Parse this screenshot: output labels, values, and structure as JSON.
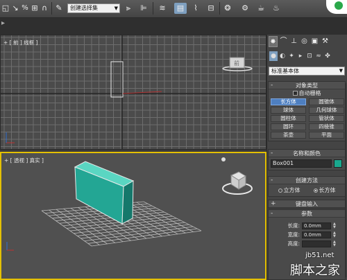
{
  "toolbar": {
    "selection_set_value": "创建选择集",
    "icons": [
      "select-object-icon",
      "select-name-icon",
      "percent-snap-icon",
      "spinner-snap-icon",
      "magnet-icon",
      "edit-named-selections-icon",
      "mirror-icon",
      "align-icon",
      "layer-manager-icon",
      "ribbon-icon",
      "curve-editor-icon",
      "schematic-view-icon",
      "material-editor-icon",
      "render-setup-icon",
      "rendered-frame-icon",
      "render-icon"
    ]
  },
  "viewports": {
    "top_label": "+ [ 前 ] 线框 ]",
    "persp_label": "+ [ 透视 ] 真实 ]",
    "viewcube_top_text": "前"
  },
  "panel": {
    "tabs": [
      "create-tab",
      "modify-tab",
      "hierarchy-tab",
      "motion-tab",
      "display-tab",
      "utilities-tab"
    ],
    "category_value": "标准基本体",
    "object_type": {
      "header": "对象类型",
      "autogrid_label": "自动栅格",
      "buttons": [
        "长方体",
        "圆锥体",
        "球体",
        "几何球体",
        "圆柱体",
        "管状体",
        "圆环",
        "四棱锥",
        "茶壶",
        "平面"
      ],
      "active_button": "长方体"
    },
    "name_color": {
      "header": "名称和颜色",
      "name_value": "Box001",
      "color": "#19a88e"
    },
    "creation_method": {
      "header": "创建方法",
      "options": [
        "立方体",
        "长方体"
      ],
      "selected": "长方体"
    },
    "keyboard_entry": {
      "header": "键盘输入"
    },
    "parameters": {
      "header": "参数",
      "length_label": "长度:",
      "length_value": "0.0mm",
      "width_label": "宽度:",
      "width_value": "0.0mm",
      "height_label": "高度:"
    }
  },
  "watermark": {
    "site": "jb51.net",
    "brand": "脚本之家"
  }
}
